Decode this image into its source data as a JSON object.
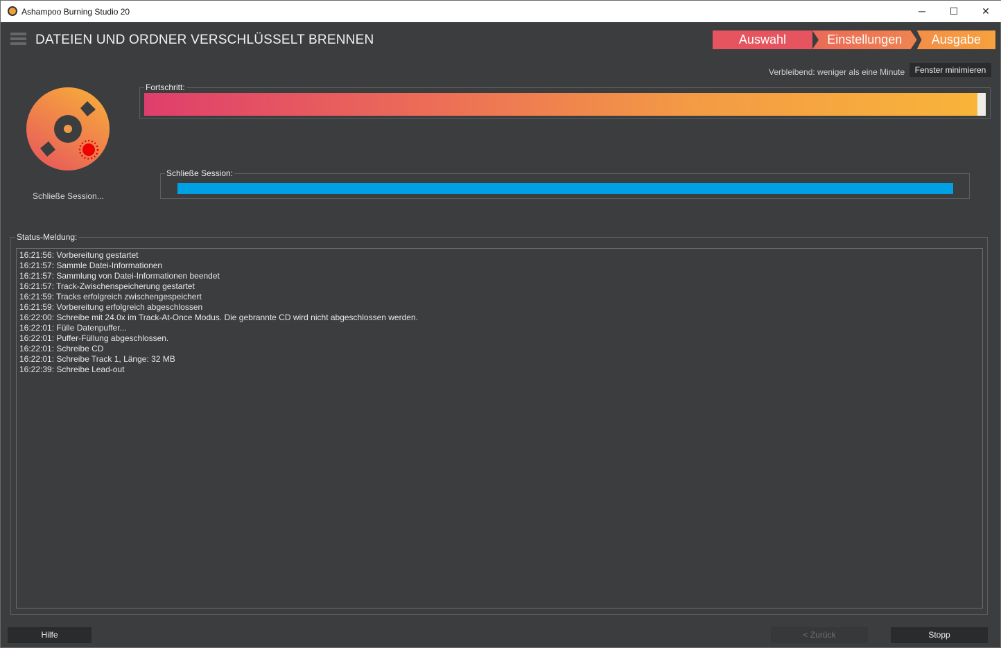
{
  "window": {
    "title": "Ashampoo Burning Studio 20",
    "minimize": "─",
    "maximize": "☐",
    "close": "✕"
  },
  "header": {
    "title": "DATEIEN UND ORDNER VERSCHLÜSSELT BRENNEN",
    "steps": [
      {
        "label": "Auswahl"
      },
      {
        "label": "Einstellungen"
      },
      {
        "label": "Ausgabe"
      }
    ]
  },
  "status": {
    "remaining": "Verbleibend: weniger als eine Minute",
    "minimize_button": "Fenster minimieren",
    "disc_label": "Schließe Session..."
  },
  "progress": {
    "label": "Fortschritt:",
    "value_percent": 99
  },
  "session": {
    "label": "Schließe Session:",
    "value_percent": 100
  },
  "log": {
    "label": "Status-Meldung:",
    "lines": [
      "16:21:56: Vorbereitung gestartet",
      "16:21:57: Sammle Datei-Informationen",
      "16:21:57: Sammlung von Datei-Informationen beendet",
      "16:21:57: Track-Zwischenspeicherung gestartet",
      "16:21:59: Tracks erfolgreich zwischengespeichert",
      "16:21:59: Vorbereitung erfolgreich abgeschlossen",
      "16:22:00: Schreibe mit 24.0x im Track-At-Once Modus. Die gebrannte CD wird nicht abgeschlossen werden.",
      "16:22:01: Fülle Datenpuffer...",
      "16:22:01: Puffer-Füllung abgeschlossen.",
      "16:22:01: Schreibe CD",
      "16:22:01: Schreibe Track 1, Länge: 32 MB",
      "16:22:39: Schreibe Lead-out"
    ]
  },
  "footer": {
    "help": "Hilfe",
    "back": "< Zurück",
    "stop": "Stopp"
  }
}
